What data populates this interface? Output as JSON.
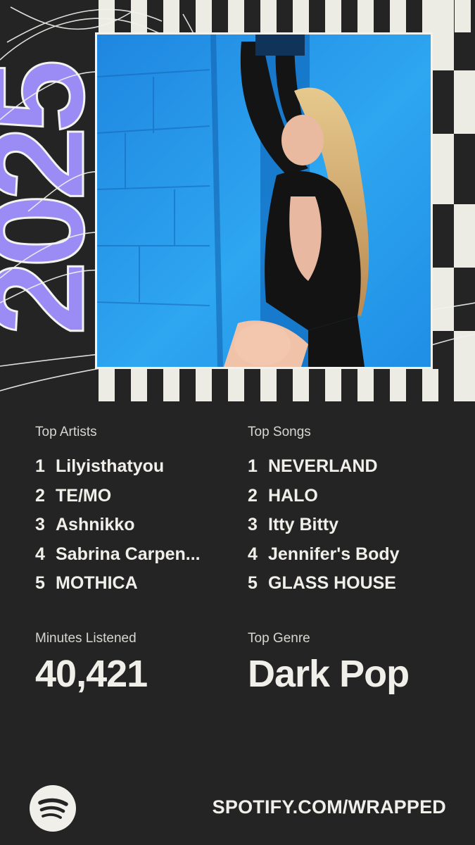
{
  "hero": {
    "year": "2025",
    "photo_description_icon": "artist-photo"
  },
  "stats": {
    "top_artists": {
      "heading": "Top Artists",
      "items": [
        {
          "rank": "1",
          "name": "Lilyisthatyou"
        },
        {
          "rank": "2",
          "name": "TE/MO"
        },
        {
          "rank": "3",
          "name": "Ashnikko"
        },
        {
          "rank": "4",
          "name": "Sabrina Carpen..."
        },
        {
          "rank": "5",
          "name": "MOTHICA"
        }
      ]
    },
    "top_songs": {
      "heading": "Top Songs",
      "items": [
        {
          "rank": "1",
          "name": "NEVERLAND"
        },
        {
          "rank": "2",
          "name": "HALO"
        },
        {
          "rank": "3",
          "name": "Itty Bitty"
        },
        {
          "rank": "4",
          "name": "Jennifer's Body"
        },
        {
          "rank": "5",
          "name": "GLASS HOUSE"
        }
      ]
    },
    "minutes": {
      "label": "Minutes Listened",
      "value": "40,421"
    },
    "genre": {
      "label": "Top Genre",
      "value": "Dark Pop"
    }
  },
  "footer": {
    "logo_icon": "spotify-logo-icon",
    "url": "SPOTIFY.COM/WRAPPED"
  },
  "colors": {
    "background": "#242424",
    "text": "#f0efea",
    "accent_purple": "#9b8cf5",
    "stripe_light": "#ecebe4",
    "photo_blue": "#2b9fe8"
  }
}
